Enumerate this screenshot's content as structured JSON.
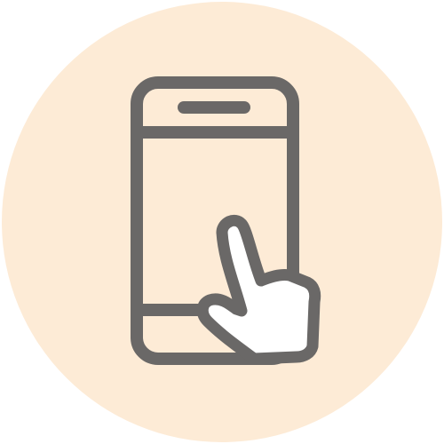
{
  "icon": {
    "name": "smartphone-touch-icon",
    "description_visible_text": ""
  },
  "colors": {
    "page_background": "#ffffff",
    "circle_background": "#fdebd6",
    "phone_fill": "#fdebd6",
    "outline": "#6a6867",
    "hand_fill": "#ffffff"
  }
}
